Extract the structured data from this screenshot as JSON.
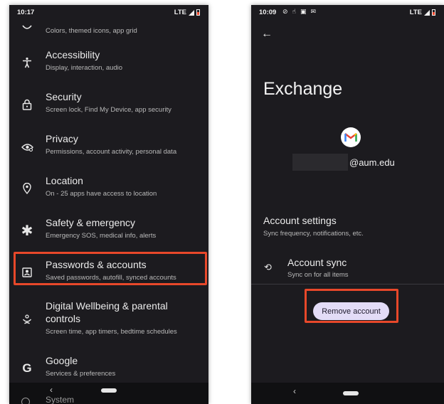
{
  "left": {
    "status": {
      "time": "10:17",
      "network": "LTE"
    },
    "top_partial_sub": "Colors, themed icons, app grid",
    "items": [
      {
        "title": "Accessibility",
        "sub": "Display, interaction, audio",
        "icon": "accessibility-icon"
      },
      {
        "title": "Security",
        "sub": "Screen lock, Find My Device, app security",
        "icon": "lock-icon"
      },
      {
        "title": "Privacy",
        "sub": "Permissions, account activity, personal data",
        "icon": "privacy-eye-icon"
      },
      {
        "title": "Location",
        "sub": "On - 25 apps have access to location",
        "icon": "location-pin-icon"
      },
      {
        "title": "Safety & emergency",
        "sub": "Emergency SOS, medical info, alerts",
        "icon": "asterisk-icon"
      },
      {
        "title": "Passwords & accounts",
        "sub": "Saved passwords, autofill, synced accounts",
        "icon": "account-box-icon"
      },
      {
        "title": "Digital Wellbeing & parental controls",
        "title_line1": "Digital Wellbeing & parental",
        "title_line2": "controls",
        "sub": "Screen time, app timers, bedtime schedules",
        "icon": "wellbeing-icon"
      },
      {
        "title": "Google",
        "sub": "Services & preferences",
        "icon": "google-g-icon"
      }
    ],
    "partial_bottom": "System",
    "nav": {
      "back": "‹"
    }
  },
  "right": {
    "status": {
      "time": "10:09",
      "network": "LTE"
    },
    "back_arrow": "←",
    "title": "Exchange",
    "email_suffix": "@aum.edu",
    "account_settings": {
      "title": "Account settings",
      "sub": "Sync frequency, notifications, etc."
    },
    "account_sync": {
      "title": "Account sync",
      "sub": "Sync on for all items"
    },
    "remove_button": "Remove account",
    "nav": {
      "back": "‹"
    }
  },
  "colors": {
    "background": "#1c1b1f",
    "highlight": "#e8482a",
    "button_bg": "#e3dcf7"
  }
}
